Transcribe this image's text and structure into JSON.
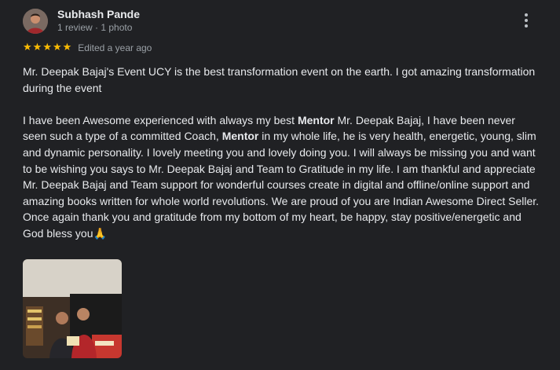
{
  "author": {
    "name": "Subhash Pande",
    "meta": "1 review · 1 photo"
  },
  "rating": {
    "stars": 5,
    "max": 5,
    "edited": "Edited a year ago"
  },
  "review": {
    "p1": "Mr. Deepak Bajaj's Event UCY is the best transformation event on the earth. I got amazing transformation during the event",
    "p2a": "I have been Awesome experienced with always my best ",
    "mentor1": "Mentor",
    "p2b": " Mr. Deepak Bajaj, I have been never seen such a type of a committed Coach, ",
    "mentor2": "Mentor",
    "p2c": " in my whole life, he is very health, energetic, young, slim and dynamic personality. I lovely meeting you and lovely doing you. I will always be missing you and want to be wishing you says to Mr. Deepak Bajaj and Team to Gratitude in my life. I am thankful and appreciate Mr. Deepak Bajaj and Team support for wonderful courses create in digital and offline/online support and amazing books written for whole world revolutions. We are proud of you are Indian Awesome Direct Seller.",
    "p3": "Once again thank you and gratitude from my bottom of my heart, be happy, stay positive/energetic and God bless you🙏"
  },
  "icons": {
    "more": "more-vert-icon",
    "star": "star-icon"
  },
  "colors": {
    "background": "#202124",
    "star": "#fbbc04",
    "text": "#e8eaed",
    "meta": "#9aa0a6"
  }
}
